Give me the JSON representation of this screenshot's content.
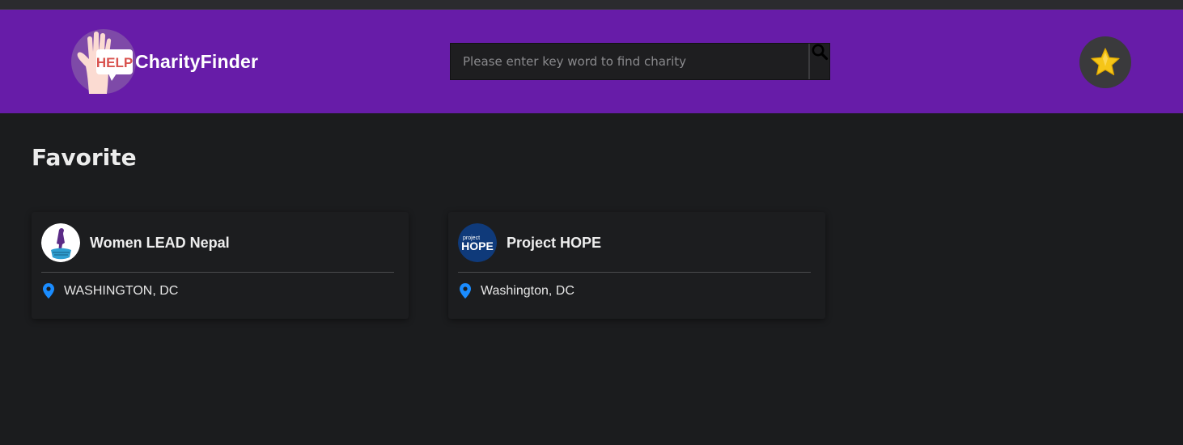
{
  "app": {
    "brand_name": "CharityFinder",
    "logo_badge_text": "HELP"
  },
  "search": {
    "placeholder": "Please enter key word to find charity",
    "value": ""
  },
  "header": {
    "favorites_icon": "star-icon"
  },
  "page": {
    "title": "Favorite"
  },
  "favorites": [
    {
      "name": "Women LEAD Nepal",
      "location": "WASHINGTON, DC",
      "avatar_icon": "women-lead-nepal-logo"
    },
    {
      "name": "Project HOPE",
      "location": "Washington, DC",
      "avatar_icon": "project-hope-logo",
      "avatar_text_top": "project",
      "avatar_text_main": "HOPE"
    }
  ],
  "colors": {
    "header_bg": "#671ca8",
    "page_bg": "#1b1c1e",
    "location_pin": "#1a8cff",
    "star": "#f5c518"
  }
}
